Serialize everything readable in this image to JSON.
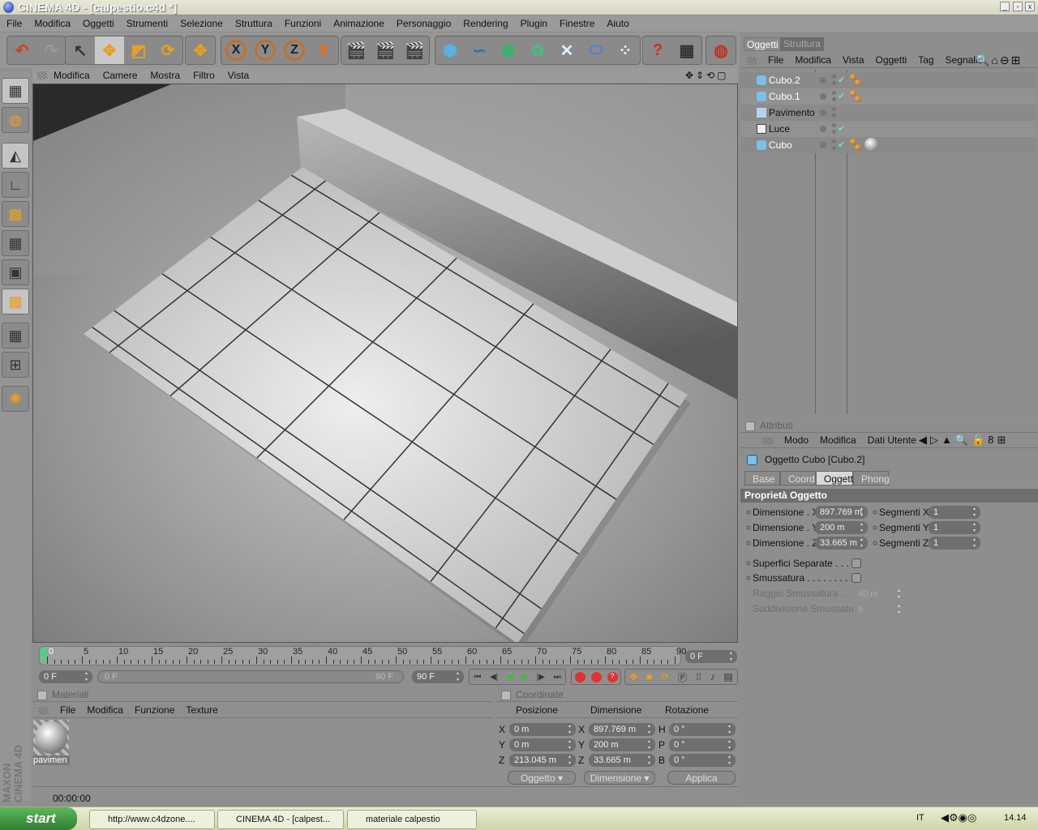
{
  "window": {
    "title": "CINEMA 4D - [calpestio.c4d *]"
  },
  "menubar": [
    "File",
    "Modifica",
    "Oggetti",
    "Strumenti",
    "Selezione",
    "Struttura",
    "Funzioni",
    "Animazione",
    "Personaggio",
    "Rendering",
    "Plugin",
    "Finestre",
    "Aiuto"
  ],
  "toolbar": {
    "icons": [
      "undo-icon",
      "redo-icon",
      "live-selection-icon",
      "move-icon",
      "scale-icon",
      "rotate-icon",
      "move-axis-icon",
      "x-axis-icon",
      "y-axis-icon",
      "z-axis-icon",
      "world-coord-icon",
      "render-view-icon",
      "render-picture-icon",
      "render-settings-icon",
      "cube-icon",
      "spline-icon",
      "nurbs-icon",
      "array-icon",
      "deformer-icon",
      "scene-icon",
      "particle-icon",
      "help-icon",
      "table-icon",
      "web-icon"
    ],
    "axis_labels": [
      "X",
      "Y",
      "Z"
    ]
  },
  "viewport": {
    "menu": [
      "Modifica",
      "Camere",
      "Mostra",
      "Filtro",
      "Vista"
    ]
  },
  "objects_panel": {
    "tabs": [
      "Oggetti",
      "Struttura"
    ],
    "active_tab": "Oggetti",
    "menu": [
      "File",
      "Modifica",
      "Vista",
      "Oggetti",
      "Tag",
      "Segnalib"
    ],
    "items": [
      {
        "name": "Cubo.2",
        "icon": "cube-icon",
        "check": true,
        "tags": [
          "texture-tag"
        ],
        "selected": false
      },
      {
        "name": "Cubo.1",
        "icon": "cube-icon",
        "check": true,
        "tags": [
          "texture-tag"
        ]
      },
      {
        "name": "Pavimento",
        "icon": "floor-icon",
        "check": false,
        "tags": []
      },
      {
        "name": "Luce",
        "icon": "light-icon",
        "check": true,
        "tags": []
      },
      {
        "name": "Cubo",
        "icon": "cube-icon",
        "check": true,
        "tags": [
          "texture-tag",
          "material-tag"
        ]
      }
    ]
  },
  "attributes": {
    "header": "Attributi",
    "menu": [
      "Modo",
      "Modifica",
      "Dati Utente"
    ],
    "object_title": "Oggetto Cubo [Cubo.2]",
    "tabs": [
      "Base",
      "Coord.",
      "Oggetto",
      "Phong"
    ],
    "active_tab": "Oggetto",
    "section": "Proprietà Oggetto",
    "dims": [
      {
        "label": "Dimensione . X",
        "value": "897.769 m",
        "seg_label": "Segmenti X",
        "seg": "1"
      },
      {
        "label": "Dimensione . Y",
        "value": "200 m",
        "seg_label": "Segmenti Y",
        "seg": "1"
      },
      {
        "label": "Dimensione . Z",
        "value": "33.665 m",
        "seg_label": "Segmenti Z",
        "seg": "1"
      }
    ],
    "separate_label": "Superfici Separate . . . . .",
    "fillet_label": "Smussatura . . . . . . . . . .",
    "fillet_radius_label": "Raggio Smussatura . . . .",
    "fillet_radius": "40 m",
    "fillet_sub_label": "Suddivisione Smussatura",
    "fillet_sub": "5"
  },
  "timeline": {
    "ticks": [
      "0",
      "5",
      "10",
      "15",
      "20",
      "25",
      "30",
      "35",
      "40",
      "45",
      "50",
      "55",
      "60",
      "65",
      "70",
      "75",
      "80",
      "85",
      "90"
    ],
    "current": "0 F",
    "start": "0 F",
    "range_start": "0 F",
    "range_end": "90 F",
    "end": "90 F"
  },
  "materials": {
    "header": "Materiali",
    "menu": [
      "File",
      "Modifica",
      "Funzione",
      "Texture"
    ],
    "items": [
      {
        "name": "pavimen"
      }
    ]
  },
  "coordinates": {
    "header": "Coordinate",
    "cols": [
      "Posizione",
      "Dimensione",
      "Rotazione"
    ],
    "rows": [
      {
        "a": "X",
        "pos": "0 m",
        "b": "X",
        "dim": "897.769 m",
        "c": "H",
        "rot": "0 °"
      },
      {
        "a": "Y",
        "pos": "0 m",
        "b": "Y",
        "dim": "200 m",
        "c": "P",
        "rot": "0 °"
      },
      {
        "a": "Z",
        "pos": "213.045 m",
        "b": "Z",
        "dim": "33.665 m",
        "c": "B",
        "rot": "0 °"
      }
    ],
    "mode": "Oggetto",
    "dim_mode": "Dimensione",
    "apply": "Applica"
  },
  "status": {
    "time": "00:00:00"
  },
  "brand": "MAXON CINEMA 4D",
  "taskbar": {
    "start": "start",
    "tasks": [
      "http://www.c4dzone....",
      "CINEMA 4D - [calpest...",
      "materiale calpestio"
    ],
    "lang": "IT",
    "clock": "14.14"
  }
}
